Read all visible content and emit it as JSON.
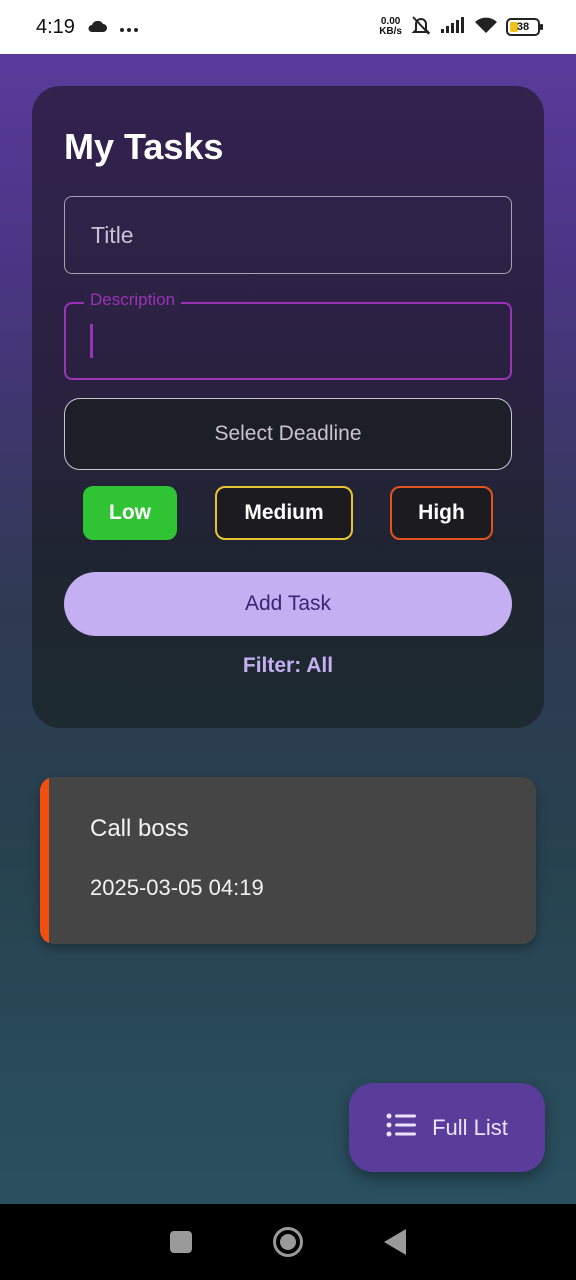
{
  "status_bar": {
    "time": "4:19",
    "netspeed_value": "0.00",
    "netspeed_unit": "KB/s",
    "battery": "38",
    "icons": [
      "cloud-icon",
      "more-dots-icon",
      "mute-icon",
      "signal-icon",
      "wifi-icon",
      "battery-icon"
    ]
  },
  "form": {
    "title": "My Tasks",
    "title_placeholder": "Title",
    "description_label": "Description",
    "deadline_label": "Select Deadline",
    "priorities": [
      "Low",
      "Medium",
      "High"
    ],
    "add_label": "Add Task",
    "filter_label": "Filter: All"
  },
  "tasks": [
    {
      "title": "Call boss",
      "deadline": "2025-03-05 04:19",
      "priority_color": "#f24e0f"
    }
  ],
  "fab": {
    "label": "Full List",
    "icon": "list-icon"
  },
  "colors": {
    "accent": "#5a3c9b",
    "button": "#c4aff2",
    "focus": "#9a33b5",
    "low": "#30c435",
    "medium": "#e8c430",
    "high": "#e2531e"
  },
  "nav": {
    "icons": [
      "recents-square-icon",
      "home-circle-icon",
      "back-triangle-icon"
    ]
  }
}
